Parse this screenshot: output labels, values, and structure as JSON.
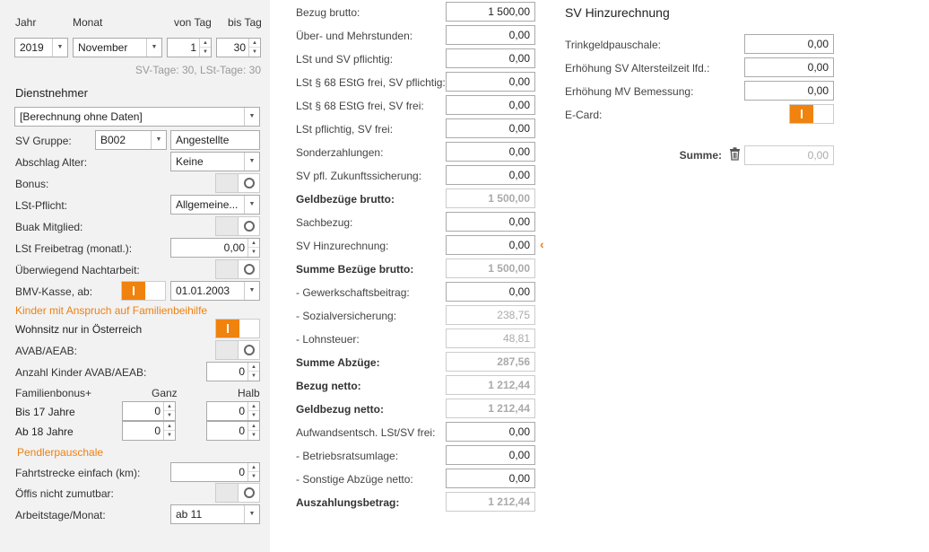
{
  "period": {
    "jahr_label": "Jahr",
    "monat_label": "Monat",
    "von_tag_label": "von Tag",
    "bis_tag_label": "bis Tag",
    "jahr_value": "2019",
    "monat_value": "November",
    "von_tag_value": "1",
    "bis_tag_value": "30",
    "tage_info": "SV-Tage: 30,  LSt-Tage: 30"
  },
  "dienstnehmer": {
    "title": "Dienstnehmer",
    "berechnung": "[Berechnung ohne Daten]",
    "sv_gruppe_label": "SV Gruppe:",
    "sv_gruppe_code": "B002",
    "sv_gruppe_text": "Angestellte",
    "abschlag_alter_label": "Abschlag Alter:",
    "abschlag_alter_value": "Keine",
    "bonus_label": "Bonus:",
    "lst_pflicht_label": "LSt-Pflicht:",
    "lst_pflicht_value": "Allgemeine...",
    "buak_label": "Buak Mitglied:",
    "lst_freibetrag_label": "LSt Freibetrag (monatl.):",
    "lst_freibetrag_value": "0,00",
    "nachtarbeit_label": "Überwiegend Nachtarbeit:",
    "bmv_label": "BMV-Kasse, ab:",
    "bmv_date": "01.01.2003"
  },
  "kinder": {
    "title": "Kinder mit Anspruch auf Familienbeihilfe",
    "wohnsitz_label": "Wohnsitz nur in Österreich",
    "avab_label": "AVAB/AEAB:",
    "anzahl_label": "Anzahl Kinder AVAB/AEAB:",
    "anzahl_value": "0",
    "familienbonus_label": "Familienbonus+",
    "ganz_label": "Ganz",
    "halb_label": "Halb",
    "bis17_label": "Bis 17 Jahre",
    "bis17_ganz": "0",
    "bis17_halb": "0",
    "ab18_label": "Ab 18 Jahre",
    "ab18_ganz": "0",
    "ab18_halb": "0"
  },
  "pendler": {
    "title": "Pendlerpauschale",
    "fahrtstrecke_label": "Fahrtstrecke einfach (km):",
    "fahrtstrecke_value": "0",
    "oeffis_label": "Öffis nicht zumutbar:",
    "arbeitstage_label": "Arbeitstage/Monat:",
    "arbeitstage_value": "ab 11"
  },
  "bezuege": [
    {
      "label": "Bezug brutto:",
      "value": "1 500,00",
      "bold": false,
      "disabled": false
    },
    {
      "label": "Über- und Mehrstunden:",
      "value": "0,00",
      "bold": false,
      "disabled": false
    },
    {
      "label": "LSt und SV pflichtig:",
      "value": "0,00",
      "bold": false,
      "disabled": false
    },
    {
      "label": "LSt § 68 EStG frei, SV pflichtig:",
      "value": "0,00",
      "bold": false,
      "disabled": false
    },
    {
      "label": "LSt § 68 EStG frei, SV frei:",
      "value": "0,00",
      "bold": false,
      "disabled": false
    },
    {
      "label": "LSt pflichtig, SV frei:",
      "value": "0,00",
      "bold": false,
      "disabled": false
    },
    {
      "label": "Sonderzahlungen:",
      "value": "0,00",
      "bold": false,
      "disabled": false
    },
    {
      "label": "SV pfl. Zukunftssicherung:",
      "value": "0,00",
      "bold": false,
      "disabled": false
    },
    {
      "label": "Geldbezüge brutto:",
      "value": "1 500,00",
      "bold": true,
      "disabled": true
    },
    {
      "label": "Sachbezug:",
      "value": "0,00",
      "bold": false,
      "disabled": false
    },
    {
      "label": "SV Hinzurechnung:",
      "value": "0,00",
      "bold": false,
      "disabled": false
    },
    {
      "label": "Summe Bezüge brutto:",
      "value": "1 500,00",
      "bold": true,
      "disabled": true
    },
    {
      "label": "- Gewerkschaftsbeitrag:",
      "value": "0,00",
      "bold": false,
      "disabled": false
    },
    {
      "label": "- Sozialversicherung:",
      "value": "238,75",
      "bold": false,
      "disabled": true
    },
    {
      "label": "- Lohnsteuer:",
      "value": "48,81",
      "bold": false,
      "disabled": true
    },
    {
      "label": "Summe Abzüge:",
      "value": "287,56",
      "bold": true,
      "disabled": true
    },
    {
      "label": "Bezug netto:",
      "value": "1 212,44",
      "bold": true,
      "disabled": true
    },
    {
      "label": "Geldbezug netto:",
      "value": "1 212,44",
      "bold": true,
      "disabled": true
    },
    {
      "label": "Aufwandsentsch. LSt/SV frei:",
      "value": "0,00",
      "bold": false,
      "disabled": false
    },
    {
      "label": "- Betriebsratsumlage:",
      "value": "0,00",
      "bold": false,
      "disabled": false
    },
    {
      "label": "- Sonstige Abzüge netto:",
      "value": "0,00",
      "bold": false,
      "disabled": false
    },
    {
      "label": "Auszahlungsbetrag:",
      "value": "1 212,44",
      "bold": true,
      "disabled": true
    }
  ],
  "sv_hinzurechnung": {
    "title": "SV Hinzurechnung",
    "trinkgeld_label": "Trinkgeldpauschale:",
    "trinkgeld_value": "0,00",
    "altersteilzeit_label": "Erhöhung SV Altersteilzeit lfd.:",
    "altersteilzeit_value": "0,00",
    "mv_label": "Erhöhung MV Bemessung:",
    "mv_value": "0,00",
    "ecard_label": "E-Card:",
    "summe_label": "Summe:",
    "summe_value": "0,00"
  },
  "colors": {
    "accent": "#f0820e",
    "panel_bg": "#f2f2f2"
  }
}
